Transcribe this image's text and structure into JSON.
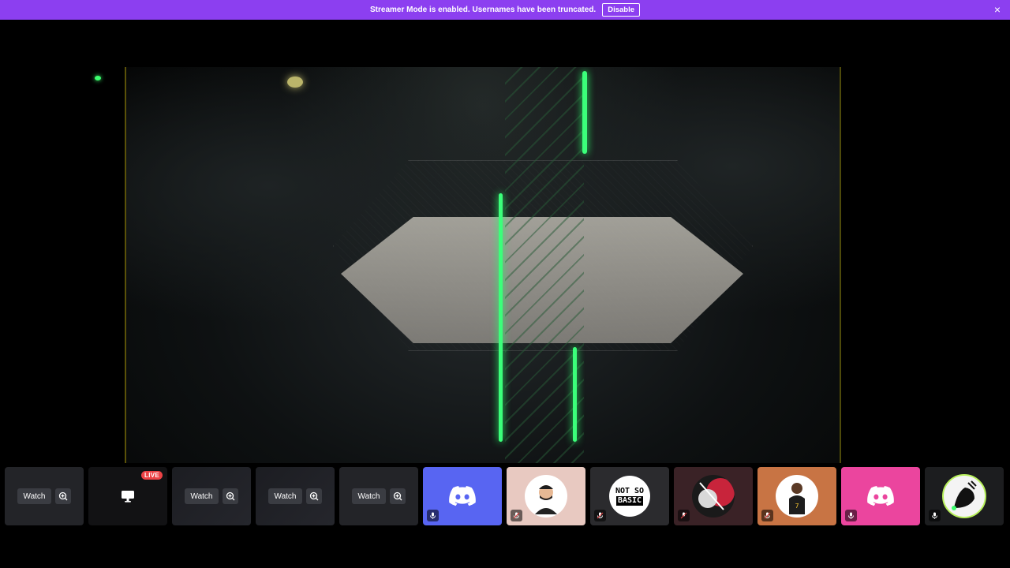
{
  "banner": {
    "message": "Streamer Mode is enabled. Usernames have been truncated.",
    "disable_label": "Disable",
    "close_glyph": "×",
    "color": "#8c3ff0"
  },
  "stage": {
    "description_icon": "stream-video"
  },
  "tiles": {
    "watch_label": "Watch",
    "live_label": "LIVE",
    "not_so_basic_line1": "NOT SO",
    "not_so_basic_line2": "BASIC"
  },
  "colors": {
    "discord_blurple": "#5865f2",
    "pink": "#eb459e",
    "live_red": "#ed4245",
    "tile_bg": "#232428"
  }
}
